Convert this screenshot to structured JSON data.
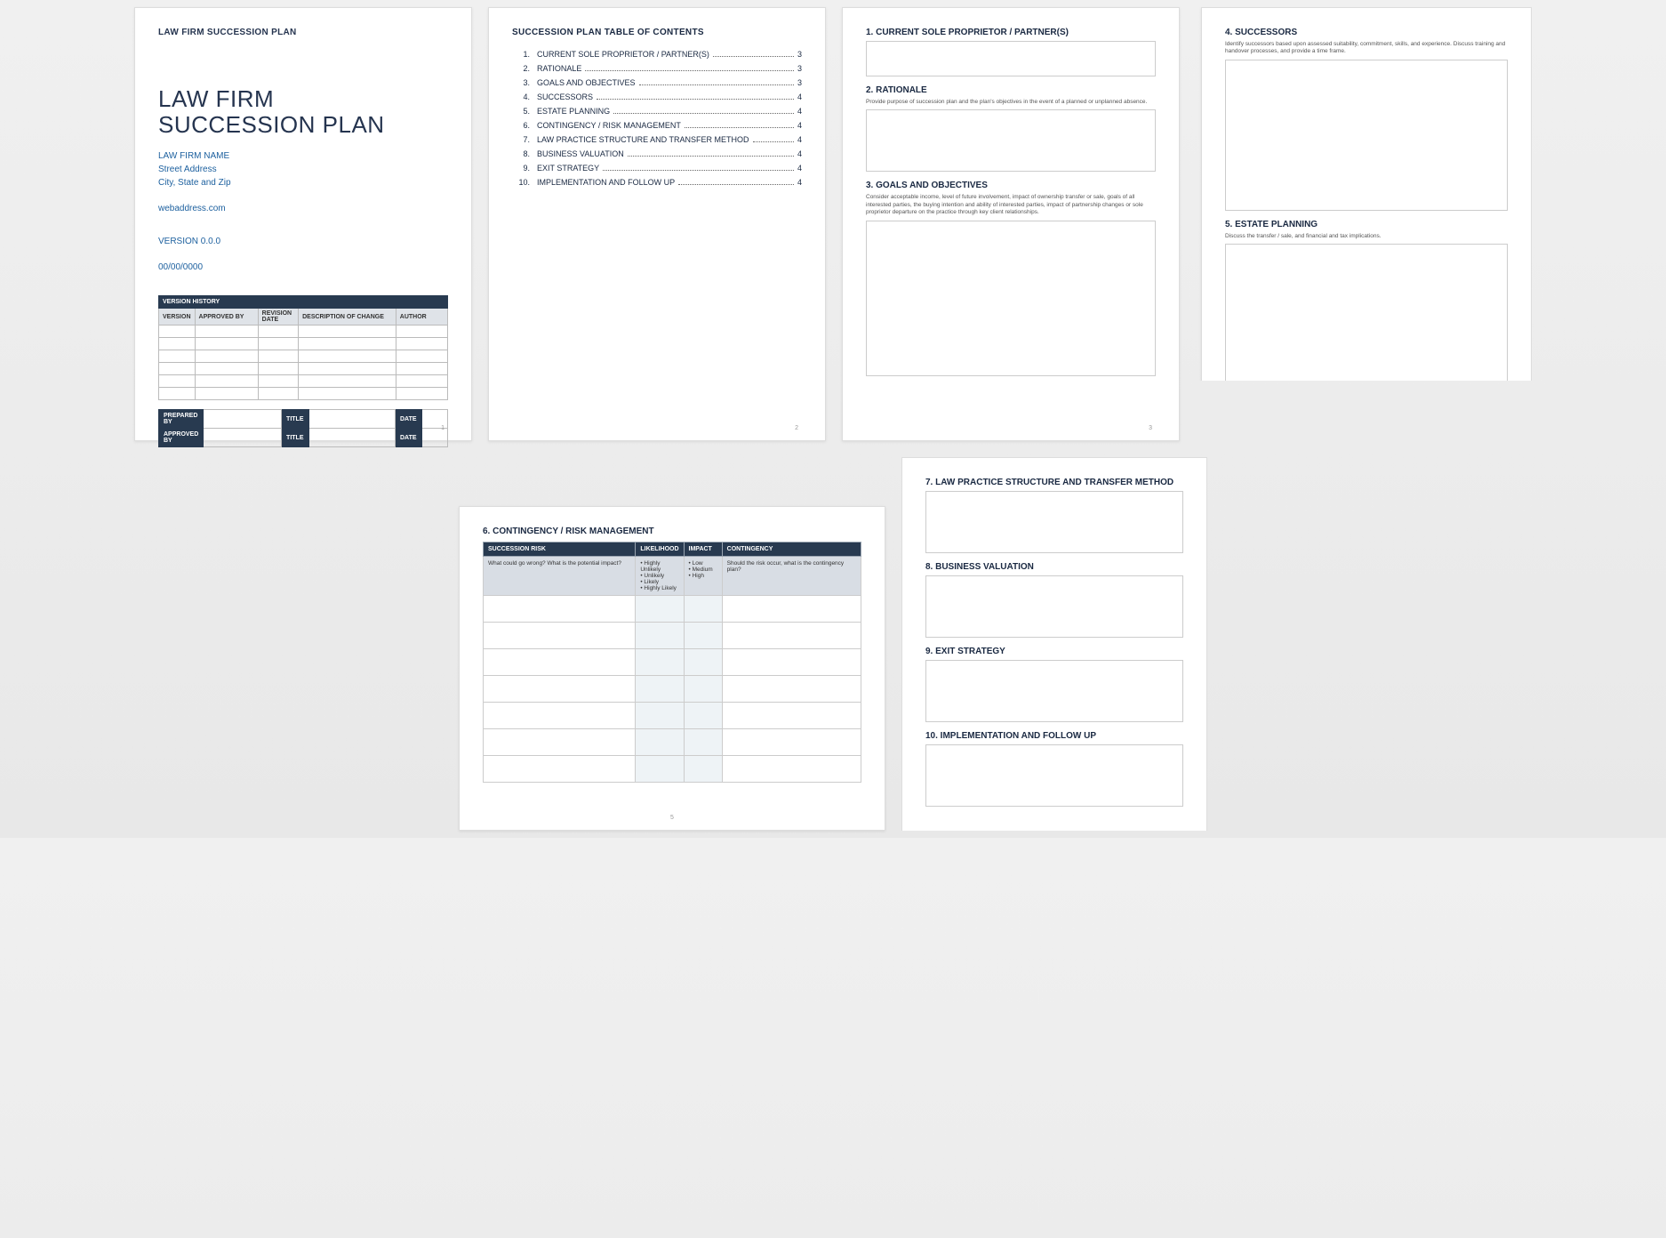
{
  "page1": {
    "header": "LAW FIRM SUCCESSION PLAN",
    "title_line1": "LAW FIRM",
    "title_line2": "SUCCESSION PLAN",
    "firm_name": "LAW FIRM NAME",
    "street": "Street Address",
    "city": "City, State and Zip",
    "web": "webaddress.com",
    "version": "VERSION 0.0.0",
    "date": "00/00/0000",
    "version_history_bar": "VERSION HISTORY",
    "vh_headers": {
      "version": "VERSION",
      "approved_by": "APPROVED BY",
      "revision_date": "REVISION DATE",
      "description": "DESCRIPTION OF CHANGE",
      "author": "AUTHOR"
    },
    "sig_labels": {
      "prepared_by": "PREPARED BY",
      "approved_by": "APPROVED BY",
      "title": "TITLE",
      "date": "DATE"
    },
    "page_number": "1"
  },
  "page2": {
    "heading": "SUCCESSION PLAN TABLE OF CONTENTS",
    "items": [
      {
        "n": "1.",
        "label": "CURRENT SOLE PROPRIETOR / PARTNER(S)",
        "pg": "3"
      },
      {
        "n": "2.",
        "label": "RATIONALE",
        "pg": "3"
      },
      {
        "n": "3.",
        "label": "GOALS AND OBJECTIVES",
        "pg": "3"
      },
      {
        "n": "4.",
        "label": "SUCCESSORS",
        "pg": "4"
      },
      {
        "n": "5.",
        "label": "ESTATE PLANNING",
        "pg": "4"
      },
      {
        "n": "6.",
        "label": "CONTINGENCY / RISK MANAGEMENT",
        "pg": "4"
      },
      {
        "n": "7.",
        "label": "LAW PRACTICE STRUCTURE AND TRANSFER METHOD",
        "pg": "4"
      },
      {
        "n": "8.",
        "label": "BUSINESS VALUATION",
        "pg": "4"
      },
      {
        "n": "9.",
        "label": "EXIT STRATEGY",
        "pg": "4"
      },
      {
        "n": "10.",
        "label": "IMPLEMENTATION AND FOLLOW UP",
        "pg": "4"
      }
    ],
    "page_number": "2"
  },
  "page3": {
    "s1_title": "1.  CURRENT SOLE PROPRIETOR / PARTNER(S)",
    "s2_title": "2.  RATIONALE",
    "s2_desc": "Provide purpose of succession plan and the plan's objectives in the event of a planned or unplanned absence.",
    "s3_title": "3.  GOALS AND OBJECTIVES",
    "s3_desc": "Consider acceptable income, level of future involvement, impact of ownership transfer or sale, goals of all interested parties, the buying intention and ability of interested parties, impact of partnership changes or sole proprietor departure on the practice through key client relationships.",
    "page_number": "3"
  },
  "page4": {
    "s4_title": "4.  SUCCESSORS",
    "s4_desc": "Identify successors based upon assessed suitability, commitment, skills, and experience.  Discuss training and handover processes, and provide a time frame.",
    "s5_title": "5.  ESTATE PLANNING",
    "s5_desc": "Discuss the transfer / sale, and financial and tax implications."
  },
  "page5": {
    "title": "6.  CONTINGENCY / RISK MANAGEMENT",
    "headers": {
      "risk": "SUCCESSION RISK",
      "likelihood": "LIKELIHOOD",
      "impact": "IMPACT",
      "contingency": "CONTINGENCY"
    },
    "help": {
      "risk": "What could go wrong? What is the potential impact?",
      "likelihood": "• Highly Unlikely\n• Unlikely\n• Likely\n• Highly Likely",
      "impact": "• Low\n• Medium\n• High",
      "contingency": "Should the risk occur, what is the contingency plan?"
    },
    "page_number": "5"
  },
  "page6": {
    "s7_title": "7.  LAW PRACTICE STRUCTURE AND TRANSFER METHOD",
    "s8_title": "8.  BUSINESS VALUATION",
    "s9_title": "9.  EXIT STRATEGY",
    "s10_title": "10.   IMPLEMENTATION AND FOLLOW UP"
  }
}
